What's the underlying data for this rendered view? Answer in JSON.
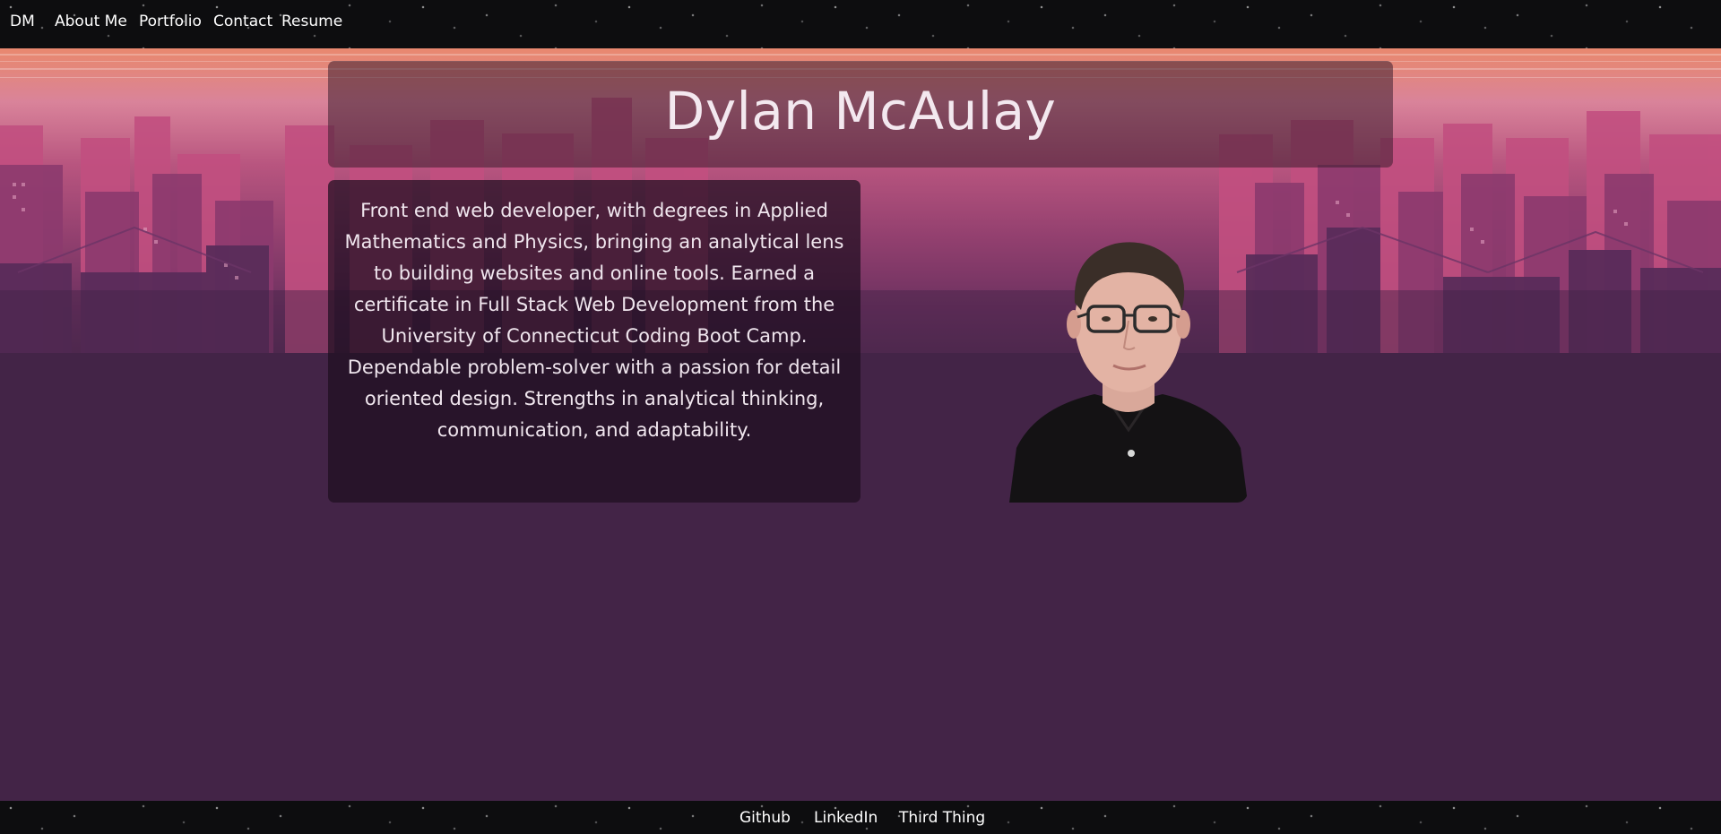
{
  "nav": {
    "brand": "DM",
    "links": [
      "About Me",
      "Portfolio",
      "Contact",
      "Resume"
    ]
  },
  "header": {
    "name": "Dylan McAulay"
  },
  "about": {
    "text": "Front end web developer, with degrees in Applied Mathematics and Physics, bringing an analytical lens to building websites and online tools. Earned a certificate in Full Stack Web Development from the University of Connecticut Coding Boot Camp. Dependable problem-solver with a passion for detail oriented design. Strengths in analytical thinking, communication, and adaptability."
  },
  "footer": {
    "links": [
      "Github",
      "LinkedIn",
      "Third Thing"
    ]
  },
  "colors": {
    "background": "#432447",
    "bar": "#0d0d0f",
    "sky_top": "#e9886f",
    "building_pink": "#c9527f",
    "text": "#ffffff"
  },
  "icons": {
    "portrait": "profile-photo"
  }
}
